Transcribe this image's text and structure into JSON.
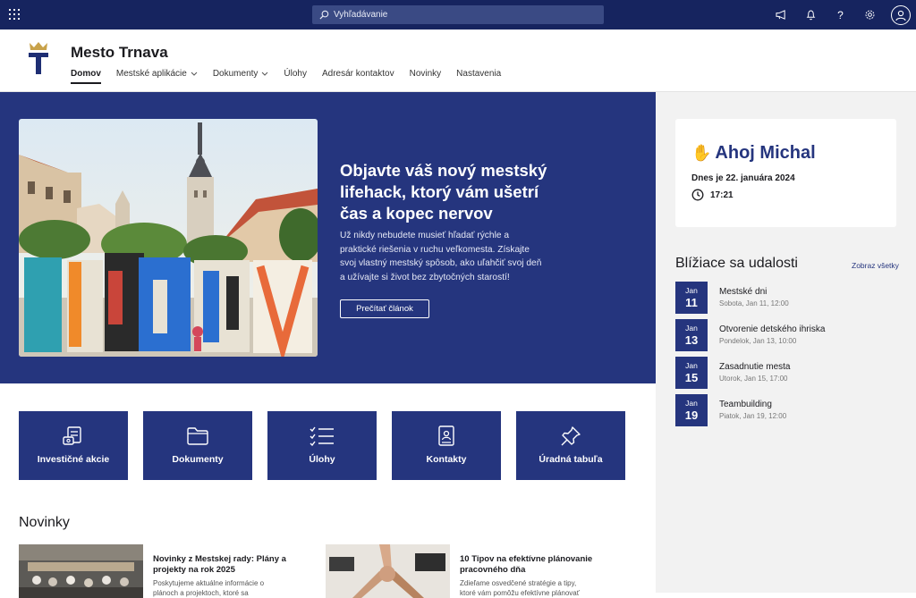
{
  "topbar": {
    "search_placeholder": "Vyhľadávanie",
    "icons": [
      "app-launcher-icon",
      "megaphone-icon",
      "bell-icon",
      "help-icon",
      "gear-icon",
      "account-icon"
    ]
  },
  "header": {
    "site_title": "Mesto Trnava",
    "nav": [
      {
        "label": "Domov",
        "active": true,
        "dropdown": false
      },
      {
        "label": "Mestské aplikácie",
        "active": false,
        "dropdown": true
      },
      {
        "label": "Dokumenty",
        "active": false,
        "dropdown": true
      },
      {
        "label": "Úlohy",
        "active": false,
        "dropdown": false
      },
      {
        "label": "Adresár kontaktov",
        "active": false,
        "dropdown": false
      },
      {
        "label": "Novinky",
        "active": false,
        "dropdown": false
      },
      {
        "label": "Nastavenia",
        "active": false,
        "dropdown": false
      }
    ]
  },
  "hero": {
    "title": "Objavte váš nový mestský lifehack, ktorý vám ušetrí čas a kopec nervov",
    "text": "Už nikdy nebudete musieť hľadať rýchle a praktické riešenia v ruchu veľkomesta. Získajte svoj vlastný mestský spôsob, ako uľahčiť svoj deň a užívajte si život bez zbytočných starostí!",
    "button": "Prečítať článok",
    "image_letters": "TRNAVA"
  },
  "greeting": {
    "title": "Ahoj Michal",
    "date": "Dnes je 22. januára 2024",
    "time": "17:21"
  },
  "events": {
    "title": "Blížiace sa udalosti",
    "link": "Zobraz všetky",
    "items": [
      {
        "month": "Jan",
        "day": "11",
        "name": "Mestské dni",
        "meta": "Sobota, Jan 11, 12:00"
      },
      {
        "month": "Jan",
        "day": "13",
        "name": "Otvorenie detského ihriska",
        "meta": "Pondelok, Jan 13, 10:00"
      },
      {
        "month": "Jan",
        "day": "15",
        "name": "Zasadnutie mesta",
        "meta": "Utorok, Jan 15, 17:00"
      },
      {
        "month": "Jan",
        "day": "19",
        "name": "Teambuilding",
        "meta": "Piatok, Jan 19, 12:00"
      }
    ]
  },
  "tiles": [
    {
      "label": "Investičné akcie",
      "icon": "invoice-icon"
    },
    {
      "label": "Dokumenty",
      "icon": "folder-icon"
    },
    {
      "label": "Úlohy",
      "icon": "checklist-icon"
    },
    {
      "label": "Kontakty",
      "icon": "contact-book-icon"
    },
    {
      "label": "Úradná tabuľa",
      "icon": "pin-icon"
    }
  ],
  "news": {
    "title": "Novinky",
    "items": [
      {
        "heading": "Novinky z Mestskej rady: Plány a projekty na rok 2025",
        "text": "Poskytujeme aktuálne informácie o plánoch a projektoch, ktoré sa"
      },
      {
        "heading": "10 Tipov na efektívne plánovanie pracovného dňa",
        "text": "Zdieľame osvedčené stratégie a tipy, ktoré vám pomôžu efektívne plánovať"
      }
    ]
  }
}
